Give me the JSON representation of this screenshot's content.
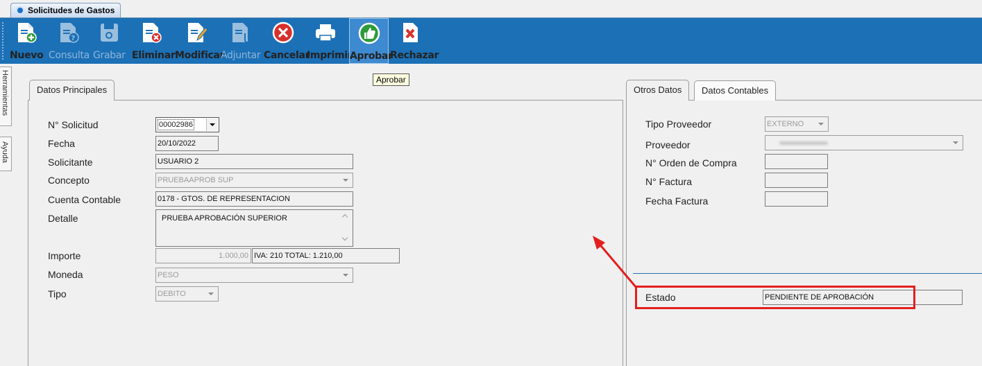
{
  "window_tab": {
    "title": "Solicitudes de Gastos"
  },
  "toolbar": {
    "nuevo": "Nuevo",
    "consulta": "Consulta",
    "grabar": "Grabar",
    "eliminar": "Eliminar",
    "modificar": "Modificar",
    "adjuntar": "Adjuntar",
    "cancelar": "Cancelar",
    "imprimir": "Imprimir",
    "aprobar": "Aprobar",
    "rechazar": "Rechazar",
    "tooltip": "Aprobar"
  },
  "side_tabs": {
    "herramientas": "Herramientas",
    "ayuda": "Ayuda"
  },
  "left_panel": {
    "tab": "Datos Principales",
    "labels": {
      "solicitud": "N° Solicitud",
      "fecha": "Fecha",
      "solicitante": "Solicitante",
      "concepto": "Concepto",
      "cuenta": "Cuenta Contable",
      "detalle": "Detalle",
      "importe": "Importe",
      "moneda": "Moneda",
      "tipo": "Tipo"
    },
    "values": {
      "solicitud": "00002986",
      "fecha": "20/10/2022",
      "solicitante": "USUARIO 2",
      "concepto": "PRUEBAAPROB SUP",
      "cuenta": "0178 - GTOS. DE REPRESENTACION",
      "detalle": "PRUEBA APROBACIÓN SUPERIOR",
      "importe": "1.000,00",
      "iva_total": "IVA: 210 TOTAL:  1.210,00",
      "moneda": "PESO",
      "tipo": "DEBITO"
    }
  },
  "right_panel": {
    "tabs": {
      "otros": "Otros Datos",
      "contables": "Datos Contables"
    },
    "labels": {
      "tipo_proveedor": "Tipo Proveedor",
      "proveedor": "Proveedor",
      "orden_compra": "N° Orden de Compra",
      "factura": "N° Factura",
      "fecha_factura": "Fecha Factura",
      "estado": "Estado"
    },
    "values": {
      "tipo_proveedor": "EXTERNO",
      "proveedor": "",
      "orden_compra": "",
      "factura": "",
      "fecha_factura": "",
      "estado": "PENDIENTE DE APROBACIÓN"
    }
  },
  "colors": {
    "toolbar": "#1c70b6",
    "highlight": "#e41e1e"
  }
}
